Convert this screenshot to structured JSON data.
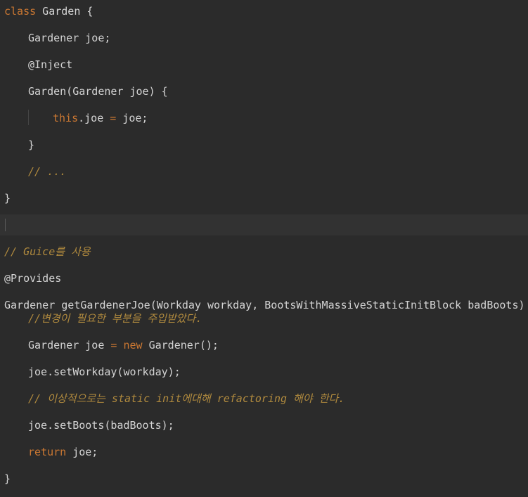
{
  "code": {
    "l1": {
      "kw": "class",
      "rest": " Garden {"
    },
    "l2": {
      "text": "Gardener joe;"
    },
    "l3": {
      "text": "@Inject"
    },
    "l4": {
      "text": "Garden(Gardener joe) {"
    },
    "l5": {
      "kw": "this",
      "mid": ".joe ",
      "op": "=",
      "rest": " joe;"
    },
    "l6": {
      "text": "}"
    },
    "l7": {
      "comment": "// ..."
    },
    "l8": {
      "text": "}"
    },
    "l10": {
      "comment": "// Guice를 사용"
    },
    "l11": {
      "text": "@Provides"
    },
    "l12": {
      "text": "Gardener getGardenerJoe(Workday workday, BootsWithMassiveStaticInitBlock badBoots) {"
    },
    "l13": {
      "comment": "//변경이 필요한 부분을 주입받았다."
    },
    "l14": {
      "pre": "Gardener joe ",
      "op": "=",
      "sp": " ",
      "kw": "new",
      "rest": " Gardener();"
    },
    "l15": {
      "text": "joe.setWorkday(workday);"
    },
    "l16": {
      "comment": "// 이상적으로는 static init에대해 refactoring 해야 한다."
    },
    "l17": {
      "text": "joe.setBoots(badBoots);"
    },
    "l18": {
      "kw": "return",
      "rest": " joe;"
    },
    "l19": {
      "text": "}"
    }
  },
  "colors": {
    "background": "#2b2b2b",
    "keyword": "#cc7832",
    "comment": "#b08a3e",
    "text": "#d4d4d4",
    "current_line": "#323232"
  }
}
